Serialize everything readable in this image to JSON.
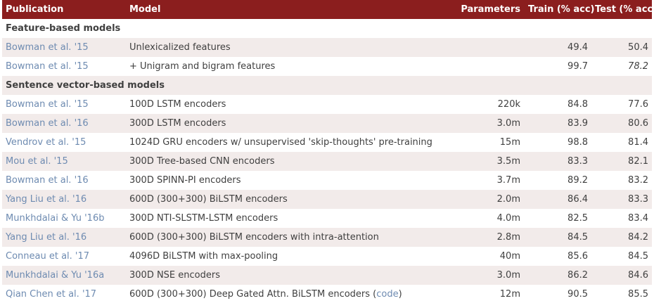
{
  "header": {
    "publication": "Publication",
    "model": "Model",
    "parameters": "Parameters",
    "train": "Train (% acc)",
    "test": "Test (% acc)"
  },
  "sections": [
    {
      "title": "Feature-based models",
      "rows": [
        {
          "publication": "Bowman et al. '15",
          "model": "Unlexicalized features",
          "parameters": "",
          "train": "49.4",
          "test": "50.4"
        },
        {
          "publication": "Bowman et al. '15",
          "model": "+ Unigram and bigram features",
          "parameters": "",
          "train": "99.7",
          "test": "78.2",
          "test_italic": true
        }
      ]
    },
    {
      "title": "Sentence vector-based models",
      "rows": [
        {
          "publication": "Bowman et al. '15",
          "model": "100D LSTM encoders",
          "parameters": "220k",
          "train": "84.8",
          "test": "77.6"
        },
        {
          "publication": "Bowman et al. '16",
          "model": "300D LSTM encoders",
          "parameters": "3.0m",
          "train": "83.9",
          "test": "80.6"
        },
        {
          "publication": "Vendrov et al. '15",
          "model": "1024D GRU encoders w/ unsupervised 'skip-thoughts' pre-training",
          "parameters": "15m",
          "train": "98.8",
          "test": "81.4"
        },
        {
          "publication": "Mou et al. '15",
          "model": "300D Tree-based CNN encoders",
          "parameters": "3.5m",
          "train": "83.3",
          "test": "82.1"
        },
        {
          "publication": "Bowman et al. '16",
          "model": "300D SPINN-PI encoders",
          "parameters": "3.7m",
          "train": "89.2",
          "test": "83.2"
        },
        {
          "publication": "Yang Liu et al. '16",
          "model": "600D (300+300) BiLSTM encoders",
          "parameters": "2.0m",
          "train": "86.4",
          "test": "83.3"
        },
        {
          "publication": "Munkhdalai & Yu '16b",
          "model": "300D NTI-SLSTM-LSTM encoders",
          "parameters": "4.0m",
          "train": "82.5",
          "test": "83.4"
        },
        {
          "publication": "Yang Liu et al. '16",
          "model": "600D (300+300) BiLSTM encoders with intra-attention",
          "parameters": "2.8m",
          "train": "84.5",
          "test": "84.2"
        },
        {
          "publication": "Conneau et al. '17",
          "model": "4096D BiLSTM with max-pooling",
          "parameters": "40m",
          "train": "85.6",
          "test": "84.5"
        },
        {
          "publication": "Munkhdalai & Yu '16a",
          "model": "300D NSE encoders",
          "parameters": "3.0m",
          "train": "86.2",
          "test": "84.6"
        },
        {
          "publication": "Qian Chen et al. '17",
          "model": "600D (300+300) Deep Gated Attn. BiLSTM encoders (",
          "model_link": "code",
          "model_suffix": ")",
          "parameters": "12m",
          "train": "90.5",
          "test": "85.5"
        }
      ]
    }
  ],
  "colors": {
    "header_bg": "#8b1e1e",
    "row_shade": "#f2ebea",
    "link": "#6e8bb1"
  }
}
